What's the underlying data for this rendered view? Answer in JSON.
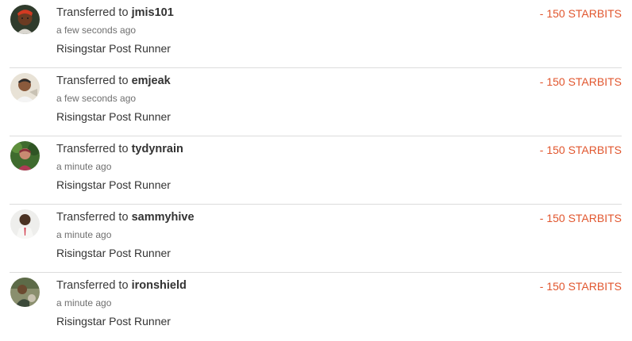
{
  "transfers": [
    {
      "prefix": "Transferred to",
      "username": "jmis101",
      "time": "a few seconds ago",
      "memo": "Risingstar Post Runner",
      "amount": "- 150 STARBITS",
      "avatar_icon": "user-avatar-icon"
    },
    {
      "prefix": "Transferred to",
      "username": "emjeak",
      "time": "a few seconds ago",
      "memo": "Risingstar Post Runner",
      "amount": "- 150 STARBITS",
      "avatar_icon": "user-avatar-icon"
    },
    {
      "prefix": "Transferred to",
      "username": "tydynrain",
      "time": "a minute ago",
      "memo": "Risingstar Post Runner",
      "amount": "- 150 STARBITS",
      "avatar_icon": "user-avatar-icon"
    },
    {
      "prefix": "Transferred to",
      "username": "sammyhive",
      "time": "a minute ago",
      "memo": "Risingstar Post Runner",
      "amount": "- 150 STARBITS",
      "avatar_icon": "user-avatar-icon"
    },
    {
      "prefix": "Transferred to",
      "username": "ironshield",
      "time": "a minute ago",
      "memo": "Risingstar Post Runner",
      "amount": "- 150 STARBITS",
      "avatar_icon": "user-avatar-icon"
    }
  ],
  "colors": {
    "amount": "#e1562e",
    "divider": "#dcdcdc",
    "muted_text": "#6f6f6f"
  }
}
